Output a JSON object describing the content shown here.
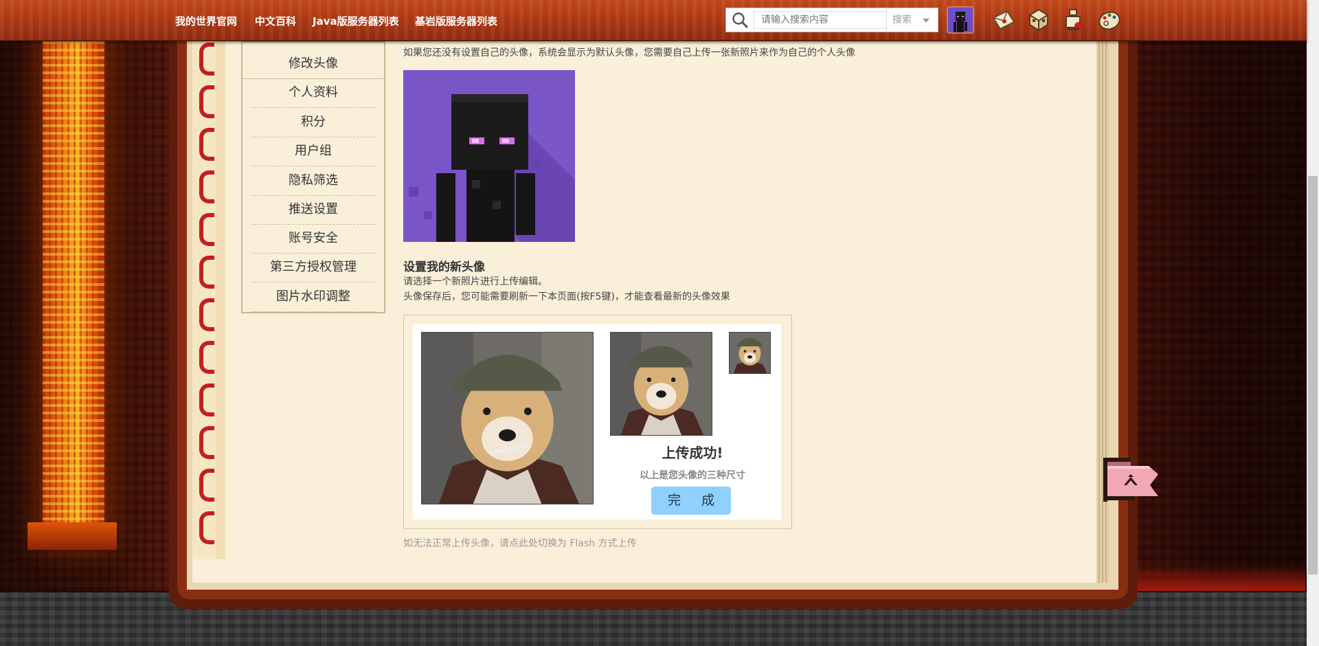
{
  "nav": {
    "links": [
      "我的世界官网",
      "中文百科",
      "Java版服务器列表",
      "基岩版服务器列表"
    ]
  },
  "search": {
    "placeholder": "请输入搜索内容",
    "button_label": "搜索"
  },
  "toolbar_icons": [
    "mail-icon",
    "chest-icon",
    "notification-icon",
    "palette-icon"
  ],
  "sidebar": {
    "items": [
      {
        "label": "修改头像"
      },
      {
        "label": "个人资料"
      },
      {
        "label": "积分"
      },
      {
        "label": "用户组"
      },
      {
        "label": "隐私筛选"
      },
      {
        "label": "推送设置"
      },
      {
        "label": "账号安全"
      },
      {
        "label": "第三方授权管理"
      },
      {
        "label": "图片水印调整"
      }
    ]
  },
  "main": {
    "default_avatar_note": "如果您还没有设置自己的头像，系统会显示为默认头像，您需要自己上传一张新照片来作为自己的个人头像",
    "set_title": "设置我的新头像",
    "instruction_1": "请选择一个新照片进行上传编辑。",
    "instruction_2": "头像保存后，您可能需要刷新一下本页面(按F5键)，才能查看最新的头像效果",
    "success_title": "上传成功!",
    "success_sub": "以上是您头像的三种尺寸",
    "done_label": "完 成",
    "flash_link": "如无法正常上传头像，请点此处切换为 Flash 方式上传"
  },
  "colors": {
    "topbar": "#a93612",
    "page": "#faf0da",
    "done_button": "#8fd0ff",
    "ring": "#c0211e"
  }
}
